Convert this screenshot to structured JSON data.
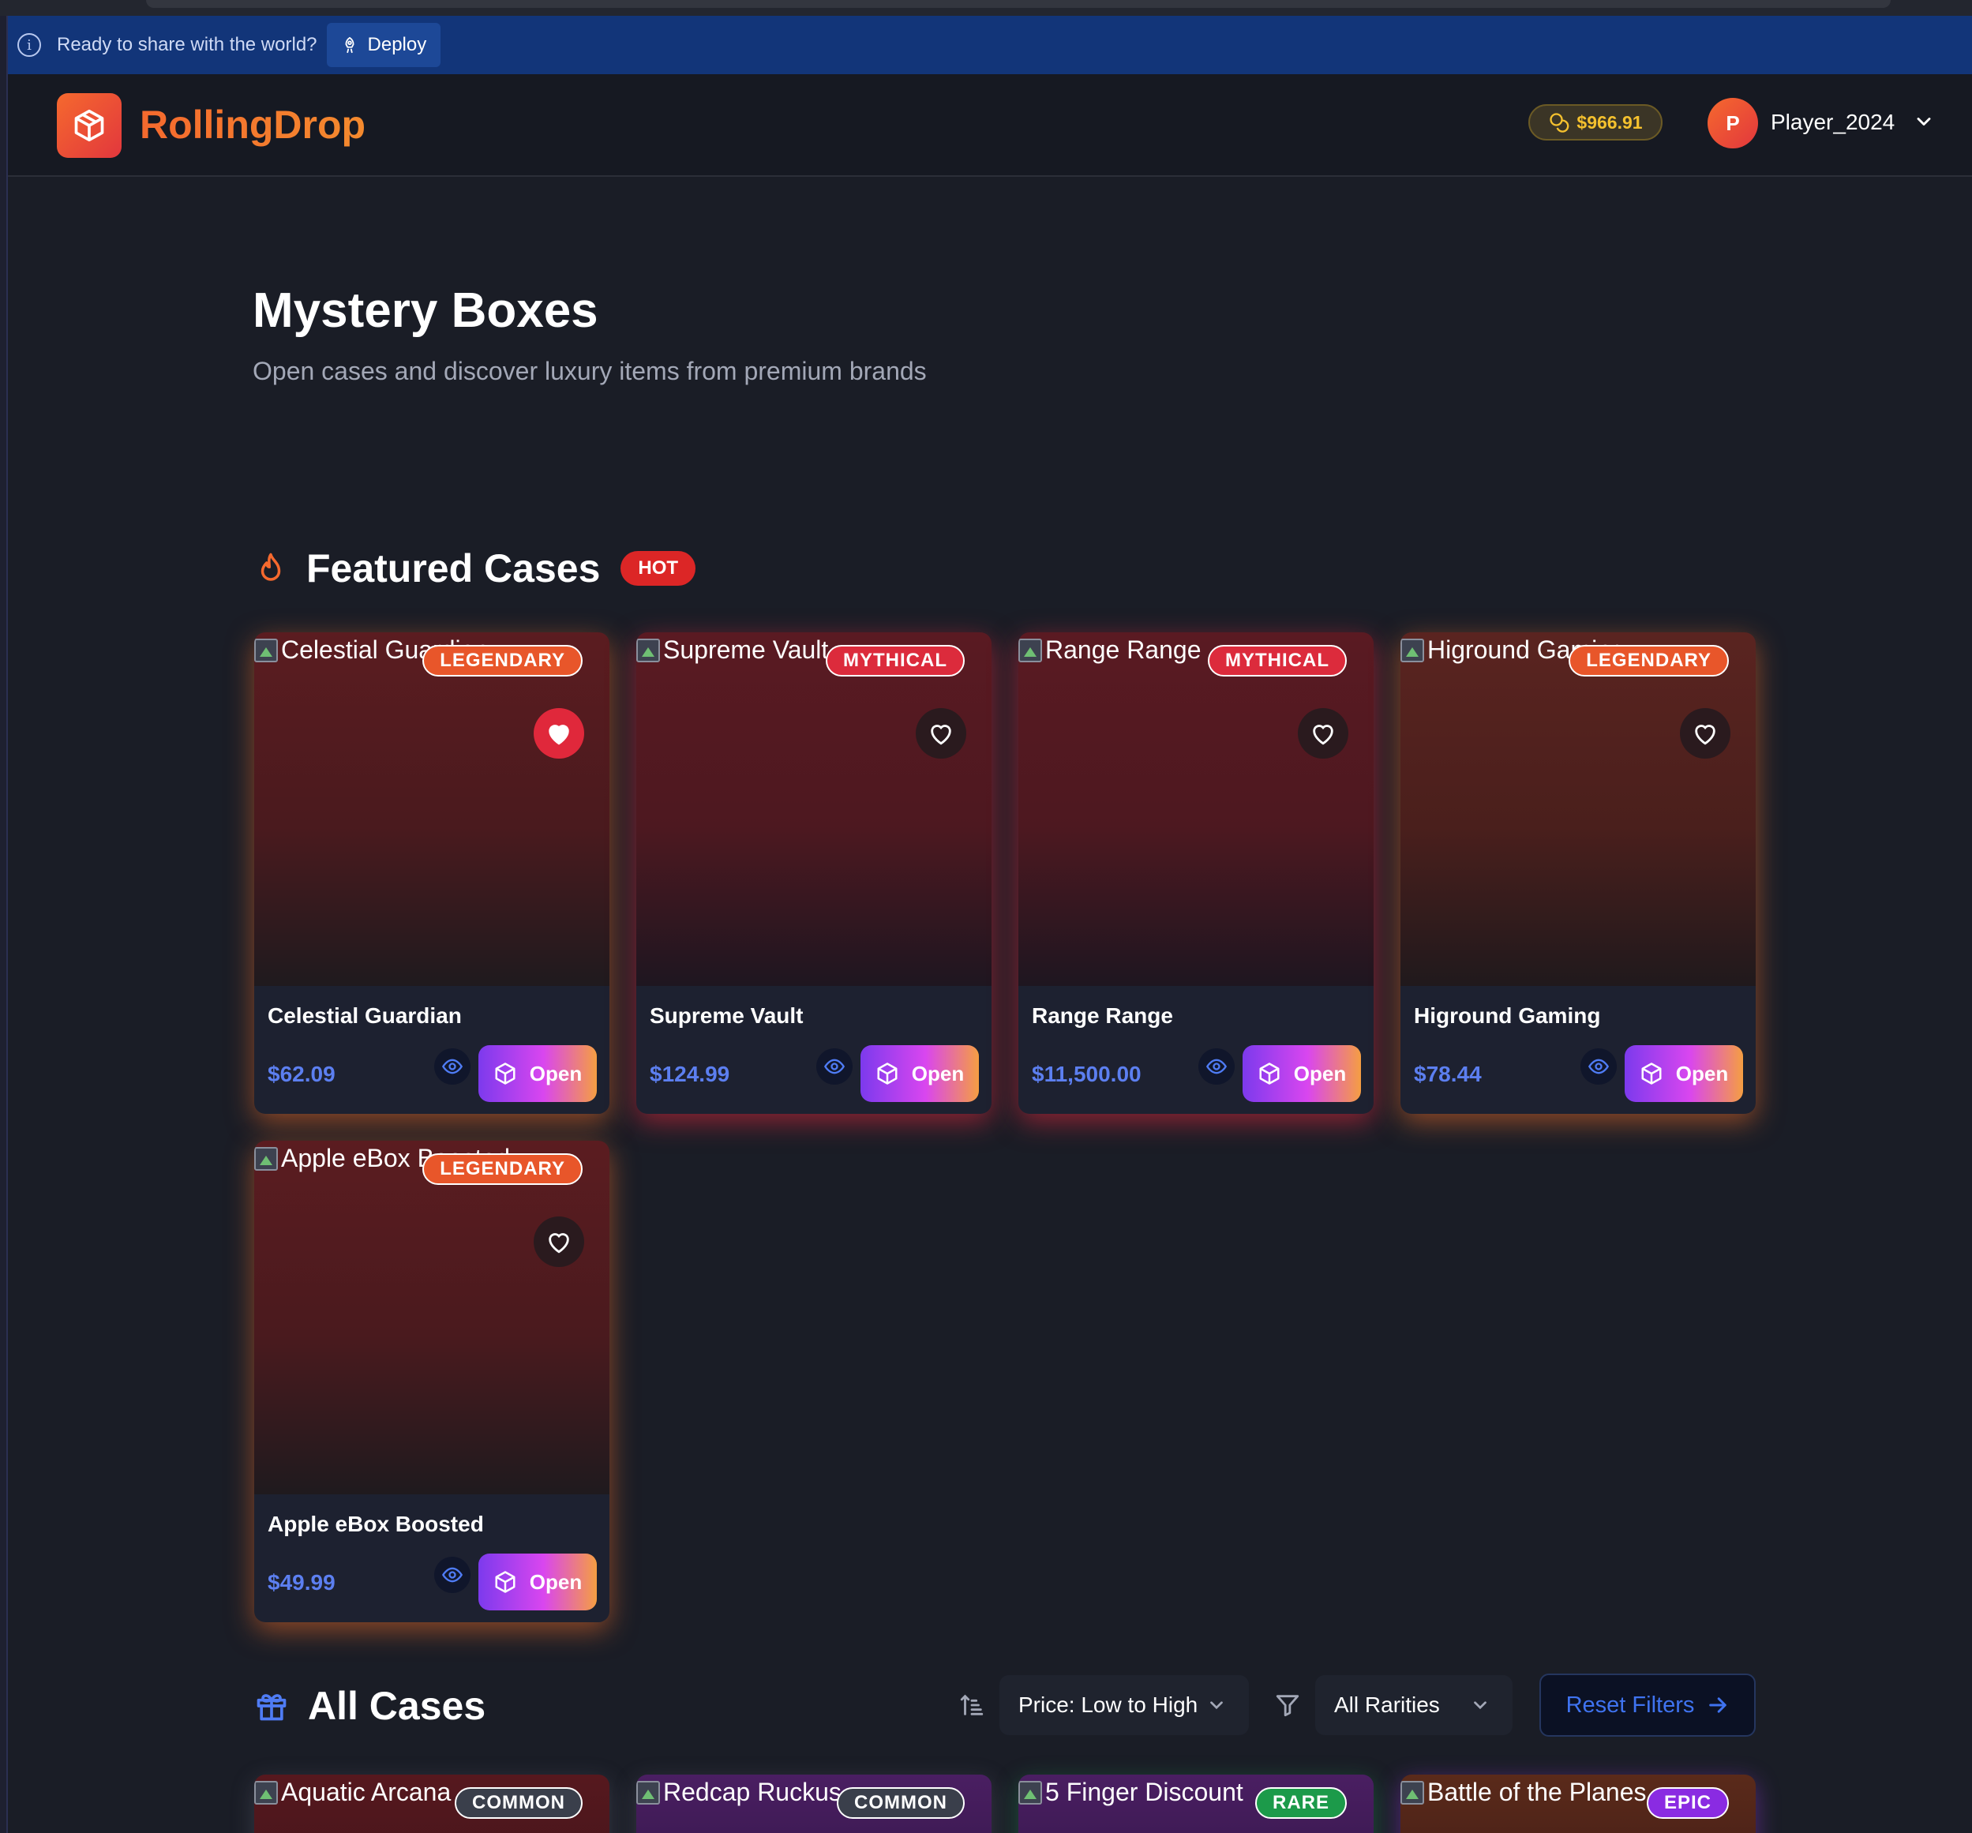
{
  "banner": {
    "message": "Ready to share with the world?",
    "deploy_label": "Deploy"
  },
  "header": {
    "brand": "RollingDrop",
    "balance": "$966.91",
    "avatar_initial": "P",
    "username": "Player_2024"
  },
  "page": {
    "title": "Mystery Boxes",
    "subtitle": "Open cases and discover luxury items from premium brands"
  },
  "featured": {
    "title": "Featured Cases",
    "badge": "HOT",
    "open_label": "Open",
    "cards": [
      {
        "alt": "Celestial Guardian",
        "rarity": "LEGENDARY",
        "name": "Celestial Guardian",
        "price": "$62.09",
        "favorited": true
      },
      {
        "alt": "Supreme Vault",
        "rarity": "MYTHICAL",
        "name": "Supreme Vault",
        "price": "$124.99",
        "favorited": false
      },
      {
        "alt": "Range Range",
        "rarity": "MYTHICAL",
        "name": "Range Range",
        "price": "$11,500.00",
        "favorited": false
      },
      {
        "alt": "Higround Gaming",
        "rarity": "LEGENDARY",
        "name": "Higround Gaming",
        "price": "$78.44",
        "favorited": false
      },
      {
        "alt": "Apple eBox Boosted",
        "rarity": "LEGENDARY",
        "name": "Apple eBox Boosted",
        "price": "$49.99",
        "favorited": false
      }
    ]
  },
  "all_cases": {
    "title": "All Cases",
    "sort_value": "Price: Low to High",
    "rarity_value": "All Rarities",
    "reset_label": "Reset Filters",
    "cards": [
      {
        "alt": "Aquatic Arcana",
        "rarity": "COMMON"
      },
      {
        "alt": "Redcap Ruckus",
        "rarity": "COMMON"
      },
      {
        "alt": "5 Finger Discount",
        "rarity": "RARE"
      },
      {
        "alt": "Battle of the Planes",
        "rarity": "EPIC"
      }
    ]
  },
  "colors": {
    "accent_orange": "#f5692e",
    "price_blue": "#5c7ff0",
    "legendary": "#e8562a",
    "mythical": "#dc2b3c",
    "common": "#3a3f4b",
    "rare": "#1c9a4a",
    "epic": "#8a2be2"
  },
  "icons": {
    "banner": "info-icon",
    "deploy": "rocket-icon",
    "logo": "cube-icon",
    "balance": "coins-icon",
    "featured": "flame-icon",
    "all_cases": "gift-icon",
    "sort": "sort-ascending-icon",
    "filter": "filter-icon",
    "reset": "arrow-right-icon",
    "favorite": "heart-icon",
    "view": "eye-icon",
    "open": "box-icon"
  }
}
